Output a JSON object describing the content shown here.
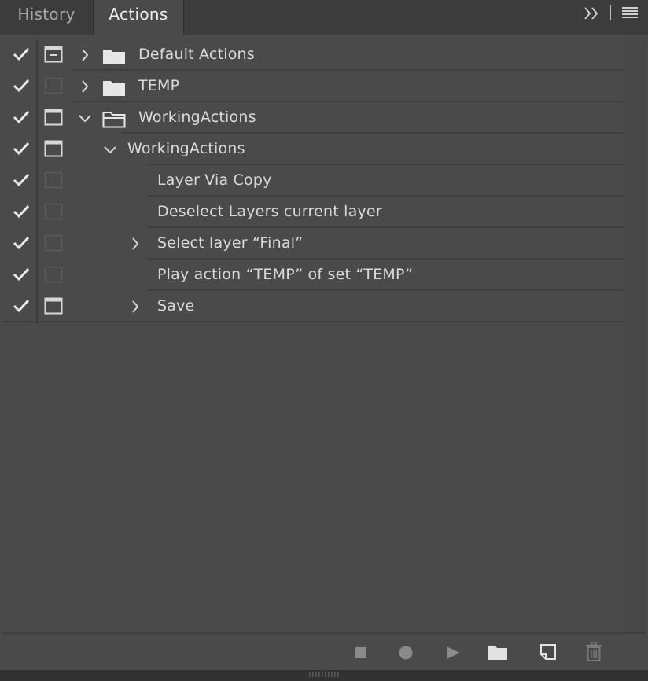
{
  "tabs": [
    {
      "label": "History",
      "active": false
    },
    {
      "label": "Actions",
      "active": true
    }
  ],
  "header_icons": {
    "collapse": "double-chevron-right-icon",
    "menu": "hamburger-menu-icon"
  },
  "rows": [
    {
      "label": "Default Actions",
      "checked": true,
      "dialog": "partial",
      "expanded": false,
      "kind": "set"
    },
    {
      "label": "TEMP",
      "checked": true,
      "dialog": "none",
      "expanded": false,
      "kind": "set"
    },
    {
      "label": "WorkingActions",
      "checked": true,
      "dialog": "on",
      "expanded": true,
      "kind": "set"
    },
    {
      "label": "WorkingActions",
      "checked": true,
      "dialog": "on",
      "expanded": true,
      "kind": "action"
    },
    {
      "label": "Layer Via Copy",
      "checked": true,
      "dialog": "none",
      "kind": "step"
    },
    {
      "label": "Deselect Layers current layer",
      "checked": true,
      "dialog": "none",
      "kind": "step"
    },
    {
      "label": "Select layer “Final”",
      "checked": true,
      "dialog": "none",
      "expandable": true,
      "kind": "step"
    },
    {
      "label": "Play action “TEMP” of set “TEMP”",
      "checked": true,
      "dialog": "none",
      "kind": "step"
    },
    {
      "label": "Save",
      "checked": true,
      "dialog": "on",
      "expandable": true,
      "kind": "step"
    }
  ],
  "toolbar": {
    "stop": "stop-icon",
    "record": "record-icon",
    "play": "play-icon",
    "new_set": "folder-icon",
    "new_action": "new-item-icon",
    "delete": "trash-icon"
  },
  "colors": {
    "panel": "#4a4a4a",
    "tabbar": "#3c3c3c",
    "text": "#dadada"
  }
}
